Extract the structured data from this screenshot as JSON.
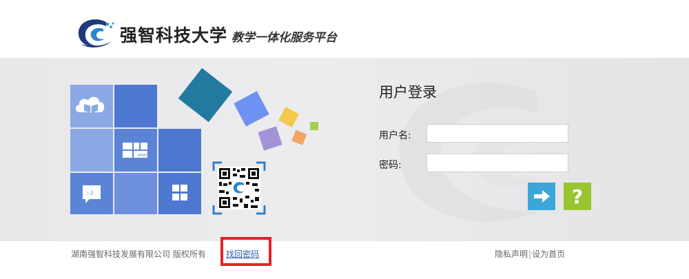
{
  "header": {
    "school_name": "强智科技大学",
    "platform_name": "教学一体化服务平台"
  },
  "tiles": {
    "ebook_icon": "cloud-book-icon",
    "news_icon": "news-icon",
    "news_text": "NEWS",
    "chat_icon": "chat-icon",
    "chat_text": ":-)",
    "grid_icon": "app-grid-icon",
    "colors": {
      "light_blue": "#8ba8e4",
      "mid_blue": "#5b84d6",
      "dark_blue": "#4e78cf",
      "teal_square": "#237aa0",
      "periwinkle_square": "#6e92f4",
      "yellow_square": "#f2c94c",
      "purple_square": "#a393d6",
      "orange_square": "#f1a560",
      "green_square": "#a3d051"
    }
  },
  "login": {
    "title": "用户登录",
    "username_label": "用户名:",
    "username_value": "",
    "password_label": "密码:",
    "password_value": "",
    "login_button_icon": "arrow-right-icon",
    "help_button_text": "?"
  },
  "footer": {
    "copyright": "湖南强智科技发展有限公司 版权所有",
    "recover_password": "找回密码",
    "privacy": "隐私声明",
    "separator": "|",
    "set_homepage": "设为首页"
  }
}
